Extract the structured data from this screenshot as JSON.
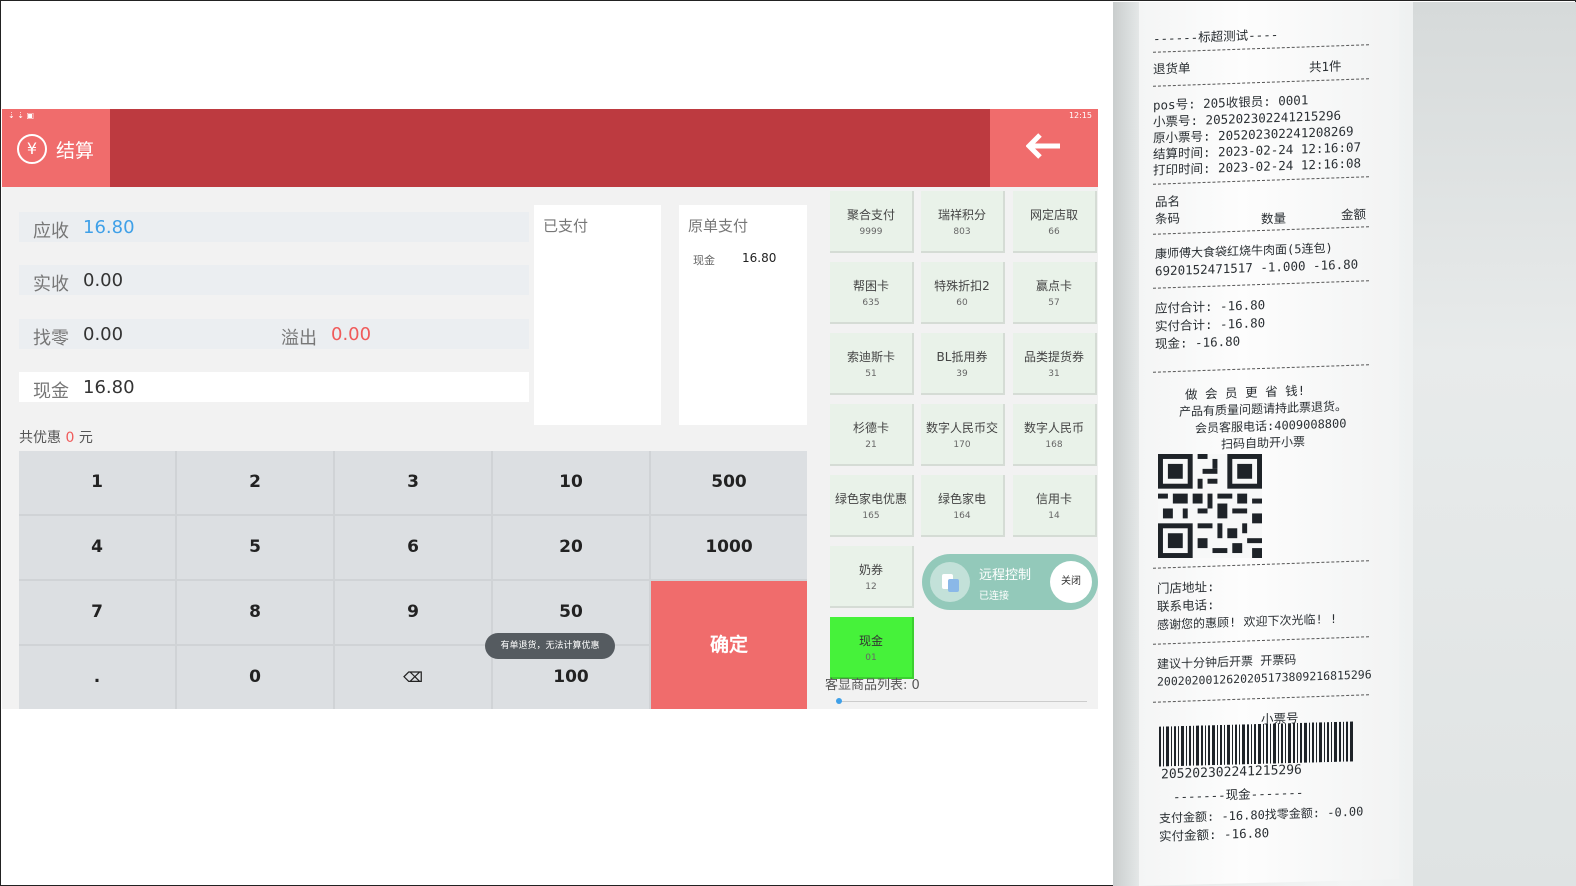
{
  "statusbar": {
    "icons_left": "⇣ ⇣ ▣",
    "time": "12:15",
    "icons_right": "▾ ▯"
  },
  "header": {
    "yen_icon": "¥",
    "title": "结算",
    "back_icon": "back-arrow-icon"
  },
  "summary": {
    "receivable_label": "应收",
    "receivable_value": "16.80",
    "received_label": "实收",
    "received_value": "0.00",
    "change_label": "找零",
    "change_value": "0.00",
    "overflow_label": "溢出",
    "overflow_value": "0.00",
    "cash_label": "现金",
    "cash_value": "16.80",
    "discount_prefix": "共优惠",
    "discount_value": "0",
    "discount_unit": "元"
  },
  "paid_panel": {
    "title": "已支付"
  },
  "original_panel": {
    "title": "原单支付",
    "method": "现金",
    "amount": "16.80"
  },
  "keypad": {
    "keys": [
      "1",
      "2",
      "3",
      "10",
      "500",
      "4",
      "5",
      "6",
      "20",
      "1000",
      "7",
      "8",
      "9",
      "50",
      ".",
      "0",
      "⌫",
      "100"
    ],
    "confirm": "确定"
  },
  "toast": "有单退货，无法计算优惠",
  "payment_methods": [
    {
      "name": "聚合支付",
      "code": "9999"
    },
    {
      "name": "瑞祥积分",
      "code": "803"
    },
    {
      "name": "网定店取",
      "code": "66"
    },
    {
      "name": "帮困卡",
      "code": "635"
    },
    {
      "name": "特殊折扣2",
      "code": "60"
    },
    {
      "name": "赢点卡",
      "code": "57"
    },
    {
      "name": "索迪斯卡",
      "code": "51"
    },
    {
      "name": "BL抵用券",
      "code": "39"
    },
    {
      "name": "品类提货券",
      "code": "31"
    },
    {
      "name": "杉德卡",
      "code": "21"
    },
    {
      "name": "数字人民币交",
      "code": "170"
    },
    {
      "name": "数字人民币",
      "code": "168"
    },
    {
      "name": "绿色家电优惠",
      "code": "165"
    },
    {
      "name": "绿色家电",
      "code": "164"
    },
    {
      "name": "信用卡",
      "code": "14"
    },
    {
      "name": "奶券",
      "code": "12"
    },
    {
      "name": "现金",
      "code": "01"
    }
  ],
  "customer_list_label": "客显商品列表: 0",
  "remote_control": {
    "title": "远程控制",
    "status": "已连接",
    "close_label": "关闭"
  },
  "receipt": {
    "header": "------标超测试----",
    "doc_type": "退货单",
    "item_count": "共1件",
    "pos_line": "pos号: 205收银员: 0001",
    "ticket_no": "小票号: 205202302241215296",
    "orig_ticket": "原小票号: 205202302241208269",
    "settle_time": "结算时间: 2023-02-24 12:16:07",
    "print_time": "打印时间: 2023-02-24 12:16:08",
    "col_name": "品名",
    "col_code": "条码",
    "col_qty": "数量",
    "col_amount": "金额",
    "item_name": "康师傅大食袋红烧牛肉面(5连包)",
    "item_line": "6920152471517   -1.000  -16.80",
    "payable": "应付合计: -16.80",
    "paid": "实付合计: -16.80",
    "cash": "现金: -16.80",
    "slogan": "做 会 员 更 省 钱!",
    "notice": "产品有质量问题请持此票退货。",
    "hotline": "会员客服电话:4009008800",
    "scan": "扫码自助开小票",
    "address": "门店地址:",
    "phone": "联系电话:",
    "thanks": "感谢您的惠顾! 欢迎下次光临! !",
    "invoice_tip": "建议十分钟后开票    开票码",
    "invoice_code": "2002020012620205173809216815296",
    "ticket_label": "小票号",
    "barcode_number": "205202302241215296",
    "cash_header": "-------现金-------",
    "pay_amount": "支付金额: -16.80找零金额: -0.00",
    "actual_amount": "实付金额: -16.80"
  }
}
